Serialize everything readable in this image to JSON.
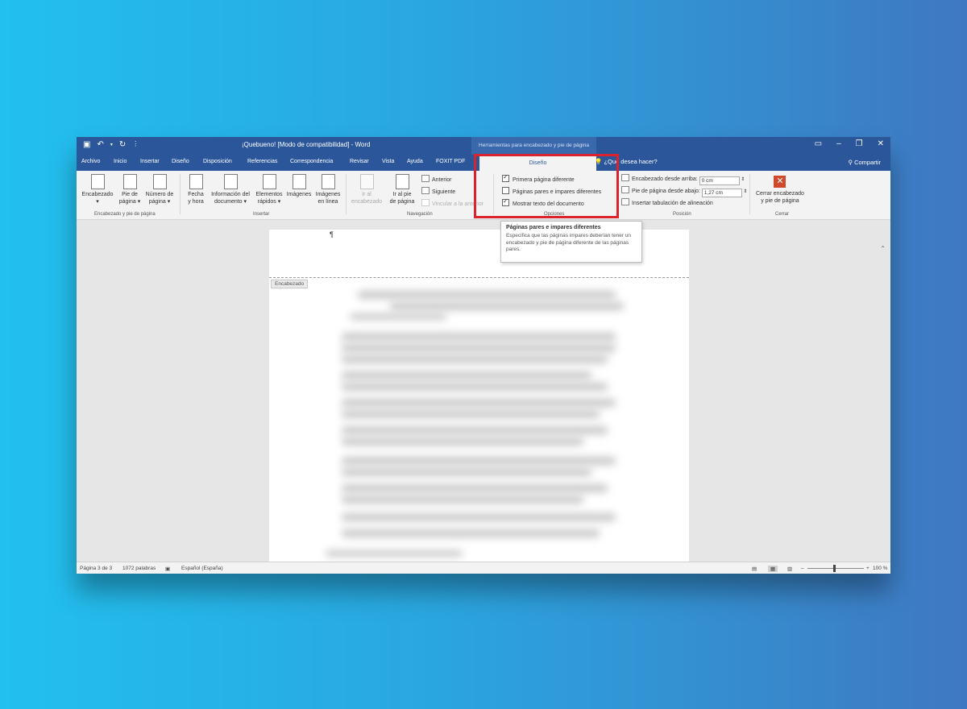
{
  "titlebar": {
    "document_title": "¡Quebueno! [Modo de compatibilidad] - Word",
    "contextual_title": "Herramientas para encabezado y pie de página"
  },
  "tabs": [
    "Archivo",
    "Inicio",
    "Insertar",
    "Diseño",
    "Disposición",
    "Referencias",
    "Correspondencia",
    "Revisar",
    "Vista",
    "Ayuda",
    "FOXIT PDF"
  ],
  "active_tab": "Diseño",
  "tell_me": "¿Qué desea hacer?",
  "share": "Compartir",
  "ribbon": {
    "header_footer_group": {
      "label": "Encabezado y pie de página",
      "buttons": [
        {
          "line1": "Encabezado",
          "line2": ""
        },
        {
          "line1": "Pie de",
          "line2": "página"
        },
        {
          "line1": "Número de",
          "line2": "página"
        }
      ]
    },
    "insert_group": {
      "label": "Insertar",
      "buttons": [
        {
          "line1": "Fecha",
          "line2": "y hora"
        },
        {
          "line1": "Información del",
          "line2": "documento"
        },
        {
          "line1": "Elementos",
          "line2": "rápidos"
        },
        {
          "line1": "Imágenes",
          "line2": ""
        },
        {
          "line1": "Imágenes",
          "line2": "en línea"
        }
      ]
    },
    "navigation_group": {
      "label": "Navegación",
      "goto_header": {
        "line1": "Ir al",
        "line2": "encabezado"
      },
      "goto_footer": {
        "line1": "Ir al pie",
        "line2": "de página"
      },
      "previous": "Anterior",
      "next": "Siguiente",
      "link_previous": "Vincular a la anterior"
    },
    "options_group": {
      "label": "Opciones",
      "items": [
        {
          "label": "Primera página diferente",
          "checked": true
        },
        {
          "label": "Páginas pares e impares diferentes",
          "checked": false
        },
        {
          "label": "Mostrar texto del documento",
          "checked": true
        }
      ]
    },
    "position_group": {
      "label": "Posición",
      "header_from_top_label": "Encabezado desde arriba:",
      "header_from_top_value": "0 cm",
      "footer_from_bottom_label": "Pie de página desde abajo:",
      "footer_from_bottom_value": "1,27 cm",
      "insert_alignment_tab": "Insertar tabulación de alineación"
    },
    "close_group": {
      "label": "Cerrar",
      "close_button_line1": "Cerrar encabezado",
      "close_button_line2": "y pie de página"
    }
  },
  "tooltip": {
    "title": "Páginas pares e impares diferentes",
    "body": "Especifica que las páginas impares deberían tener un encabezado y pie de página diferente de las páginas pares."
  },
  "document": {
    "pilcrow": "¶",
    "header_tag": "Encabezado"
  },
  "statusbar": {
    "page": "Página 3 de 3",
    "words": "1072 palabras",
    "language": "Español (España)",
    "zoom": "100 %"
  },
  "colors": {
    "word_blue": "#2b579a",
    "highlight_red": "#d9242e",
    "close_red": "#d04a2b"
  }
}
